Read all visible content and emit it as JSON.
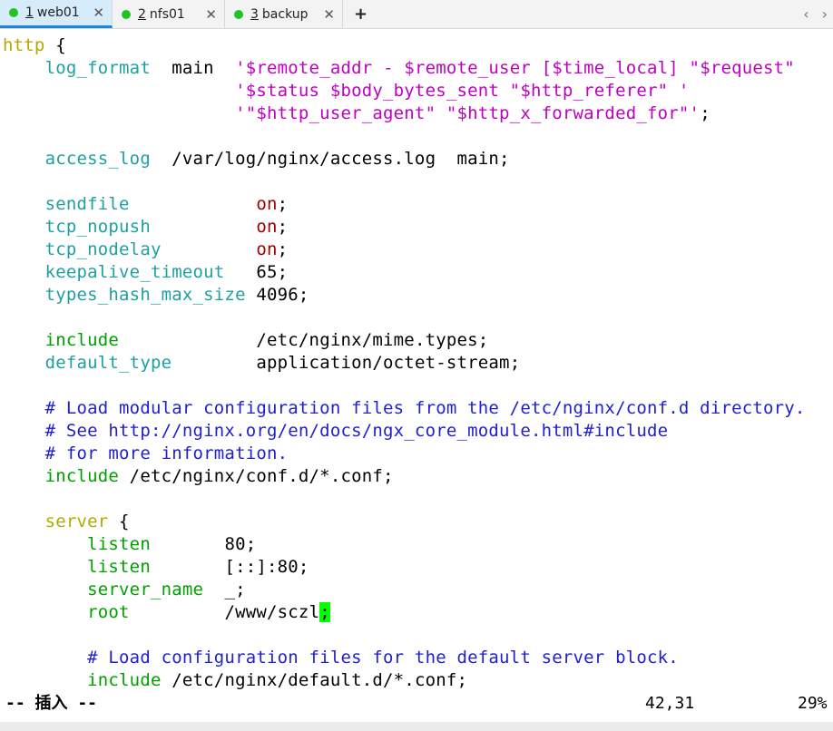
{
  "tabs": [
    {
      "num": "1",
      "name": "web01",
      "active": true,
      "dot_color": "#22c322"
    },
    {
      "num": "2",
      "name": "nfs01",
      "active": false,
      "dot_color": "#22c322"
    },
    {
      "num": "3",
      "name": "backup",
      "active": false,
      "dot_color": "#22c322"
    }
  ],
  "tabbar": {
    "add_label": "+",
    "close_label": "✕",
    "nav_left": "‹",
    "nav_right": "›"
  },
  "code": {
    "l1": "http",
    "l1b": " {",
    "l2_dir": "log_format",
    "l2_name": "  main  ",
    "l2_str": "'$remote_addr - $remote_user [$time_local] \"$request\"",
    "l3_str": "'$status $body_bytes_sent \"$http_referer\" '",
    "l4_str": "'\"$http_user_agent\" \"$http_x_forwarded_for\"'",
    "l4_end": ";",
    "l6_dir": "access_log",
    "l6_rest": "  /var/log/nginx/access.log  main;",
    "sendfile": "sendfile",
    "tcp_nopush": "tcp_nopush",
    "tcp_nodelay": "tcp_nodelay",
    "keepalive": "keepalive_timeout",
    "types_hash": "types_hash_max_size",
    "on": "on",
    "semi": ";",
    "keepalive_val": "65;",
    "types_hash_val": "4096;",
    "include": "include",
    "include_val": "/etc/nginx/mime.types;",
    "default_type": "default_type",
    "default_type_val": "application/octet-stream;",
    "c1": "# Load modular configuration files from the /etc/nginx/conf.d directory.",
    "c2": "# See http://nginx.org/en/docs/ngx_core_module.html#include",
    "c3": "# for more information.",
    "include2_val": " /etc/nginx/conf.d/*.conf;",
    "server": "server",
    "server_b": " {",
    "listen": "listen",
    "listen1_val": "80;",
    "listen2_val": "[::]:80;",
    "server_name": "server_name",
    "server_name_val": "_;",
    "root": "root",
    "root_val": "/www/sczl",
    "root_cursor": ";",
    "c4": "# Load configuration files for the default server block.",
    "include3_val": " /etc/nginx/default.d/*.conf;"
  },
  "status": {
    "mode": "-- 插入 --",
    "position": "42,31",
    "percent": "29%"
  }
}
